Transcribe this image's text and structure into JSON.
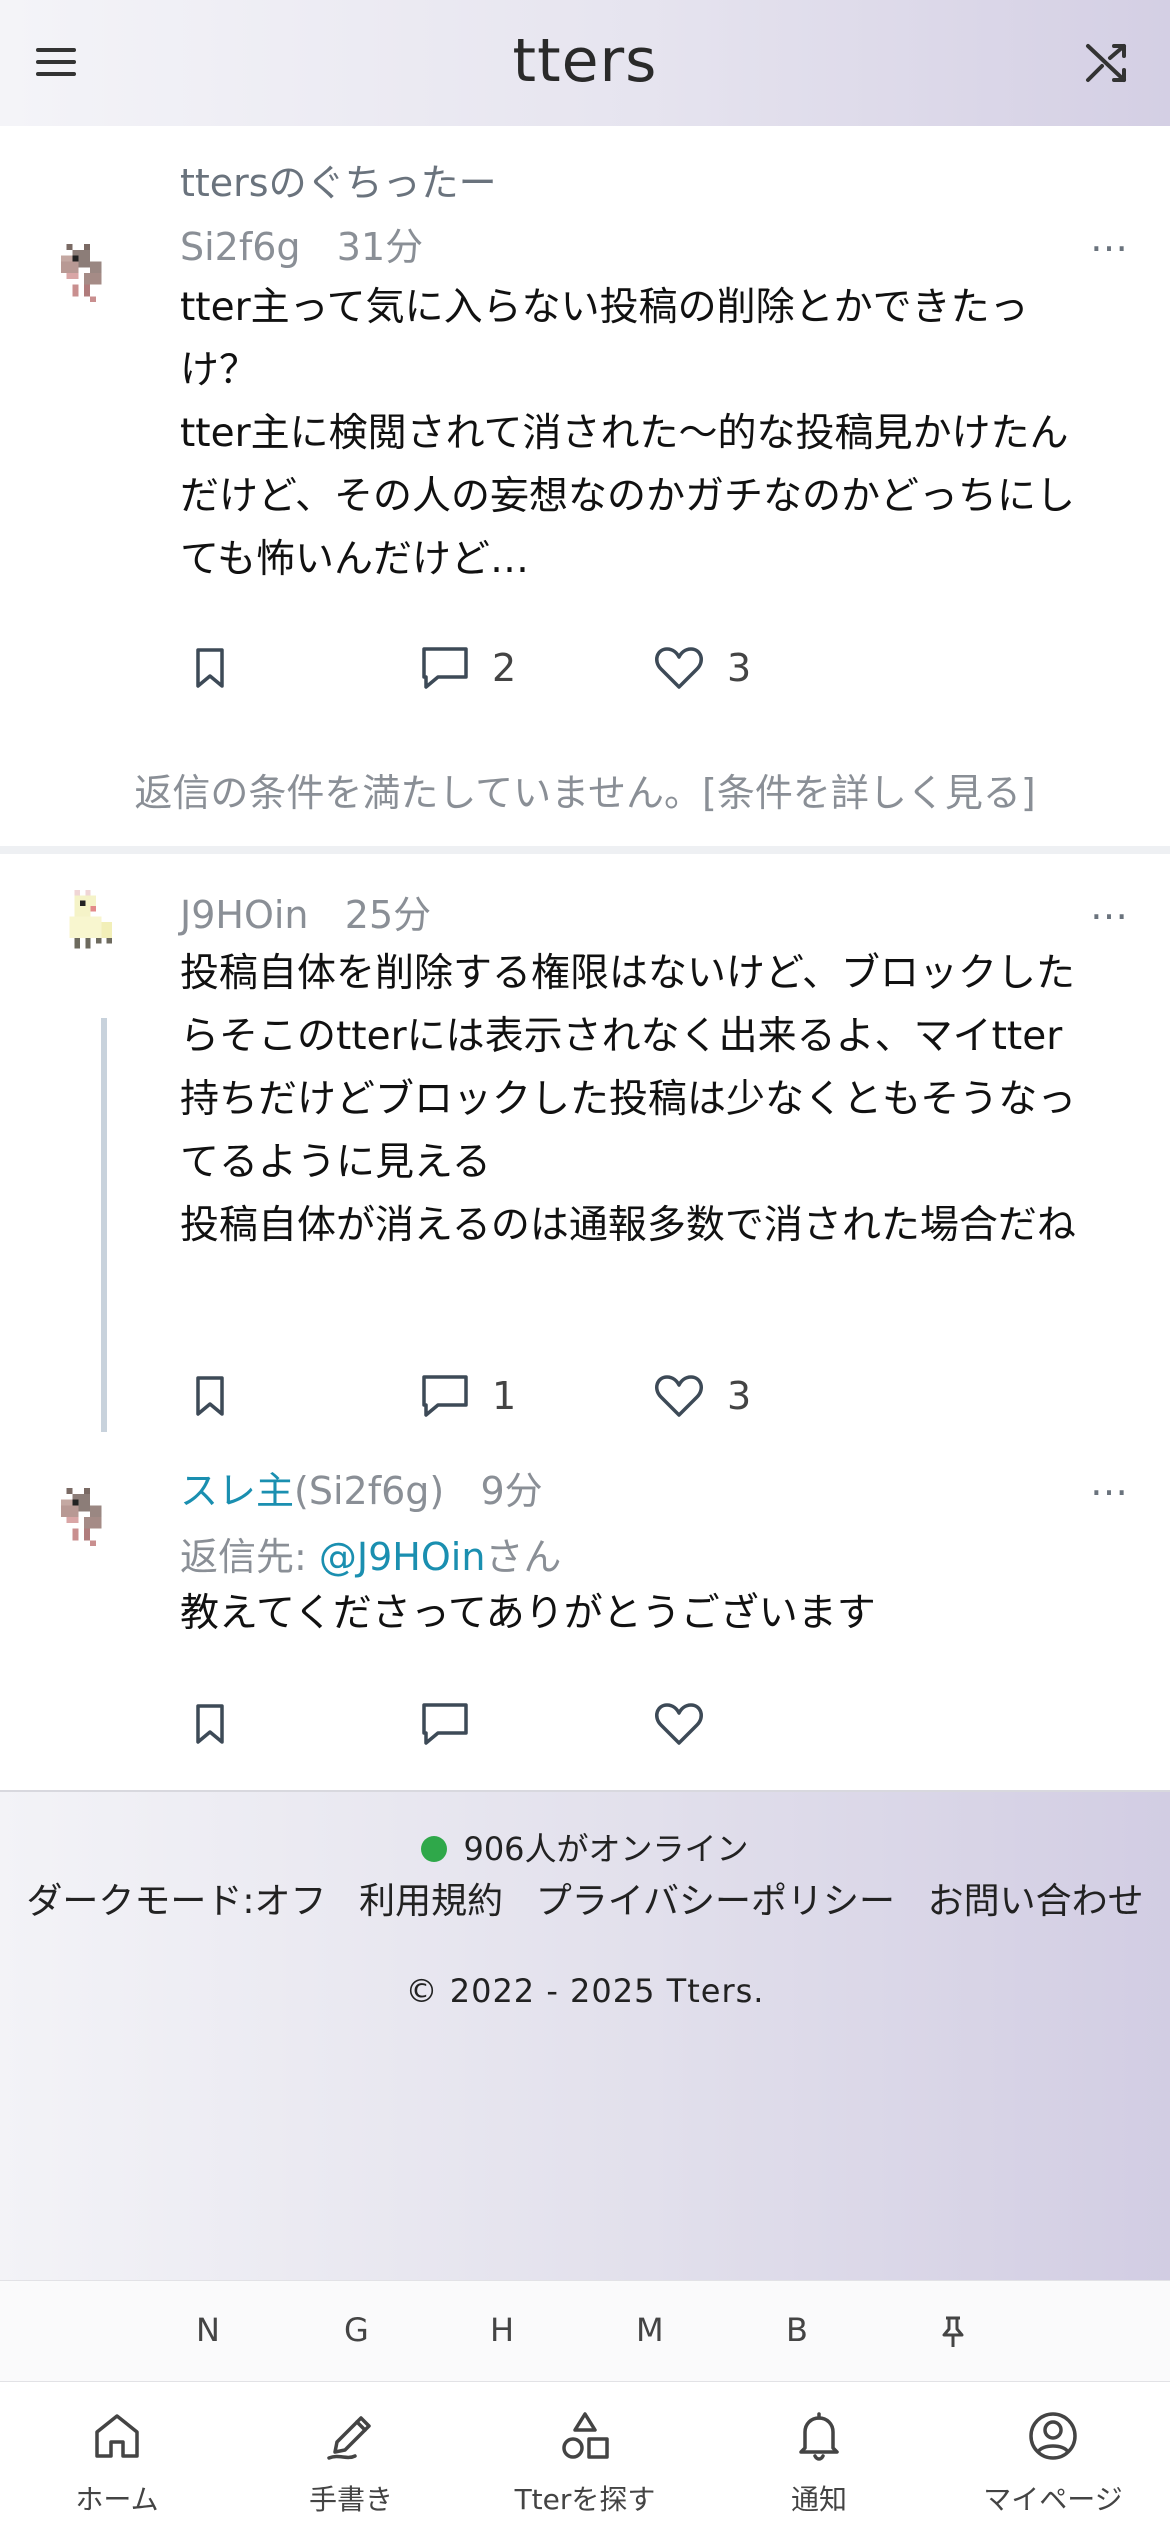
{
  "app": {
    "title": "tters"
  },
  "post1": {
    "board": "ttersのぐちったー",
    "author": "Si2f6g",
    "time": "31分",
    "more": "…",
    "body": "tter主って気に入らない投稿の削除とかできたっけ？\ntter主に検閲されて消された〜的な投稿見かけたんだけど、その人の妄想なのかガチなのかどっちにしても怖いんだけど…",
    "comments": "2",
    "likes": "3",
    "notice": "返信の条件を満たしていません。[条件を詳しく見る]"
  },
  "post2": {
    "author": "J9HOin",
    "time": "25分",
    "more": "…",
    "body": "投稿自体を削除する権限はないけど、ブロックしたらそこのtterには表示されなく出来るよ、マイtter持ちだけどブロックした投稿は少なくともそうなってるように見える\n投稿自体が消えるのは通報多数で消された場合だね",
    "comments": "1",
    "likes": "3"
  },
  "post3": {
    "op_label": "スレ主",
    "author": "(Si2f6g)",
    "time": "9分",
    "more": "…",
    "reply_prefix": "返信先: ",
    "reply_to": "@J9HOin",
    "reply_suffix": "さん",
    "body": "教えてくださってありがとうございます"
  },
  "footer": {
    "online": "906人がオンライン",
    "links": [
      "ダークモード:オフ",
      "利用規約",
      "プライバシーポリシー",
      "お問い合わせ"
    ],
    "copyright": "© 2022 - 2025 Tters."
  },
  "shortcuts": [
    "N",
    "G",
    "H",
    "M",
    "B"
  ],
  "tabs": [
    {
      "label": "ホーム",
      "icon": "home-icon"
    },
    {
      "label": "手書き",
      "icon": "pen-icon"
    },
    {
      "label": "Tterを探す",
      "icon": "shapes-icon"
    },
    {
      "label": "通知",
      "icon": "bell-icon"
    },
    {
      "label": "マイページ",
      "icon": "user-circle-icon"
    }
  ],
  "colors": {
    "accent": "#1a8fb0",
    "online": "#2fa84a"
  }
}
